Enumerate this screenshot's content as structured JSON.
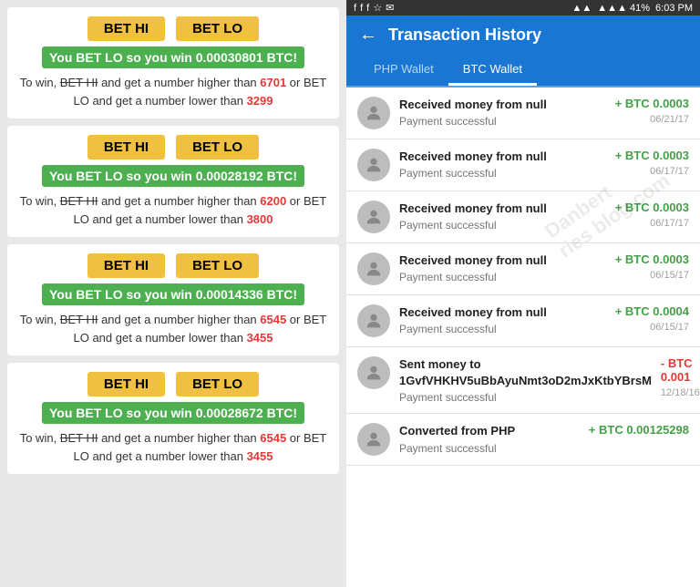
{
  "left": {
    "cards": [
      {
        "btn_hi": "BET HI",
        "btn_lo": "BET LO",
        "win_text": "You BET LO so you win 0.00030801 BTC!",
        "desc_prefix": "To win,",
        "bet_hi_strike": "BET HI",
        "desc_mid1": "and get a number higher than",
        "number_hi": "6701",
        "desc_mid2": "or BET LO and get a number lower than",
        "number_lo": "3299"
      },
      {
        "btn_hi": "BET HI",
        "btn_lo": "BET LO",
        "win_text": "You BET LO so you win 0.00028192 BTC!",
        "desc_prefix": "To win,",
        "bet_hi_strike": "BET HI",
        "desc_mid1": "and get a number higher than",
        "number_hi": "6200",
        "desc_mid2": "or BET LO and get a number lower than",
        "number_lo": "3800"
      },
      {
        "btn_hi": "BET HI",
        "btn_lo": "BET LO",
        "win_text": "You BET LO so you win 0.00014336 BTC!",
        "desc_prefix": "To win,",
        "bet_hi_strike": "BET HI",
        "desc_mid1": "and get a number higher than",
        "number_hi": "6545",
        "desc_mid2": "or BET LO and get a number lower than",
        "number_lo": "3455"
      },
      {
        "btn_hi": "BET HI",
        "btn_lo": "BET LO",
        "win_text": "You BET LO so you win 0.00028672 BTC!",
        "desc_prefix": "To win,",
        "bet_hi_strike": "BET HI",
        "desc_mid1": "and get a number higher than",
        "number_hi": "6545",
        "desc_mid2": "or BET LO and get a number lower than",
        "number_lo": "3455"
      }
    ]
  },
  "right": {
    "status_bar": {
      "icons": "f f f ☆ ✉",
      "signal": "▲▲▲ 41%",
      "time": "6:03 PM"
    },
    "header": {
      "back_label": "←",
      "title": "Transaction History"
    },
    "tabs": [
      {
        "label": "PHP Wallet",
        "active": false
      },
      {
        "label": "BTC Wallet",
        "active": true
      }
    ],
    "transactions": [
      {
        "title": "Received money from null",
        "status": "Payment successful",
        "amount": "+ BTC 0.0003",
        "date": "06/21/17",
        "positive": true
      },
      {
        "title": "Received money from null",
        "status": "Payment successful",
        "amount": "+ BTC 0.0003",
        "date": "06/17/17",
        "positive": true
      },
      {
        "title": "Received money from null",
        "status": "Payment successful",
        "amount": "+ BTC 0.0003",
        "date": "06/17/17",
        "positive": true
      },
      {
        "title": "Received money from null",
        "status": "Payment successful",
        "amount": "+ BTC 0.0003",
        "date": "06/15/17",
        "positive": true
      },
      {
        "title": "Received money from null",
        "status": "Payment successful",
        "amount": "+ BTC 0.0004",
        "date": "06/15/17",
        "positive": true
      },
      {
        "title": "Sent money to 1GvfVHKHV5uBbAyuNmt3oD2mJxKtbYBrsM",
        "status": "Payment successful",
        "amount": "- BTC 0.001",
        "date": "12/18/16",
        "positive": false
      },
      {
        "title": "Converted from PHP",
        "status": "Payment successful",
        "amount": "+ BTC 0.00125298",
        "date": "",
        "positive": true
      }
    ]
  }
}
